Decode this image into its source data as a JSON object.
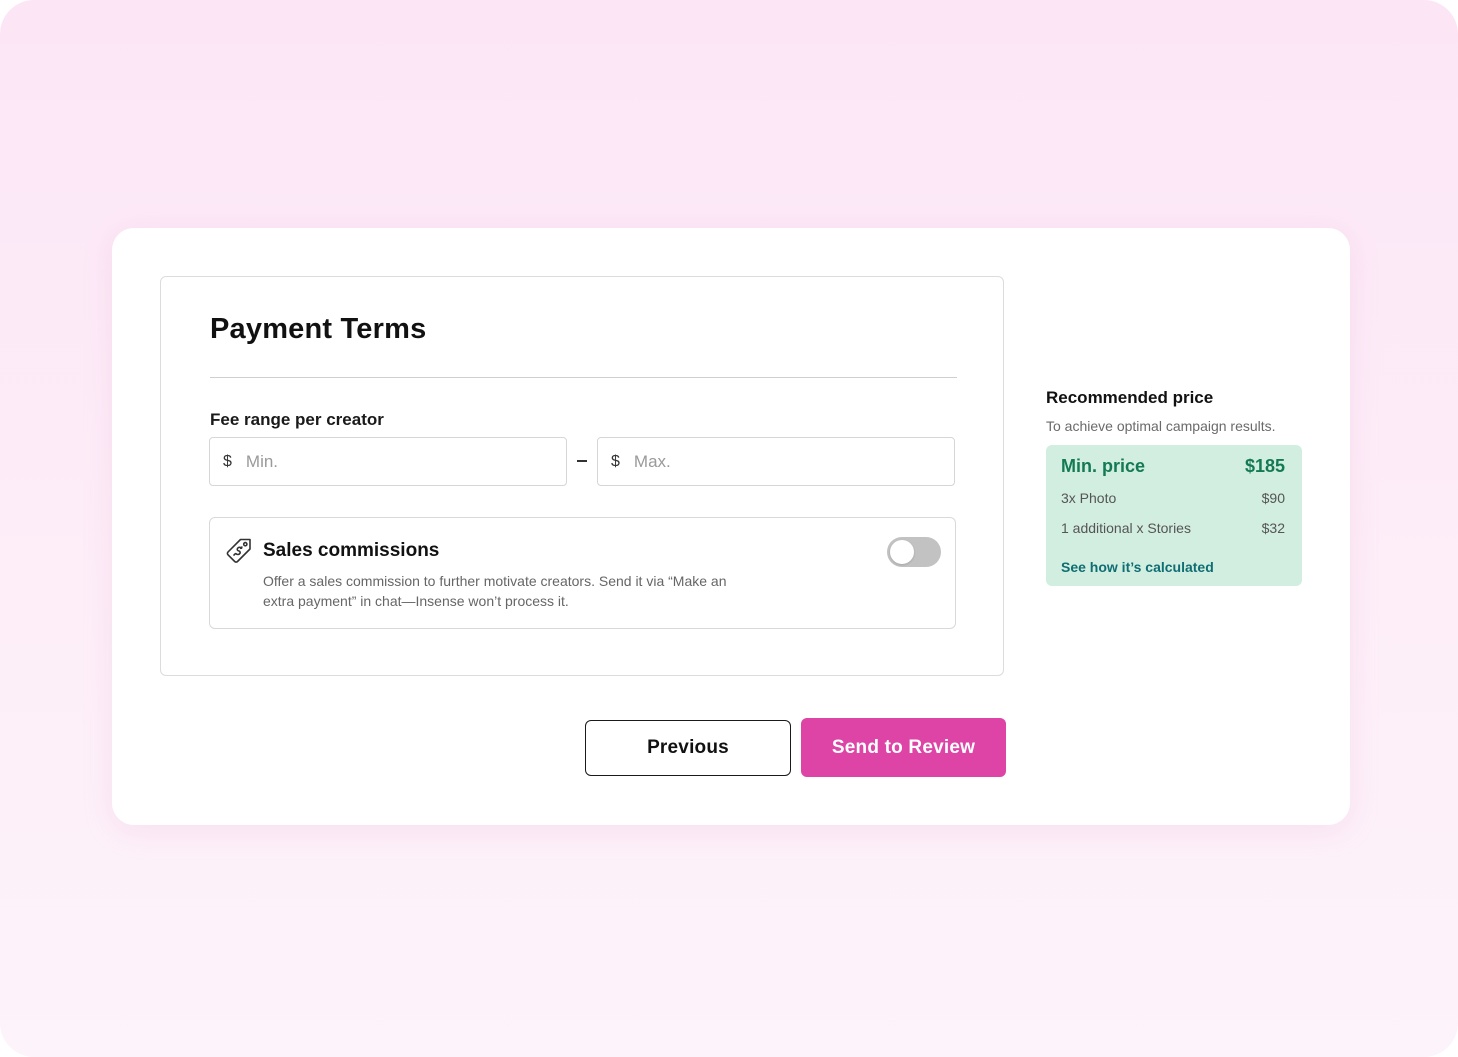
{
  "payment_terms": {
    "title": "Payment Terms",
    "fee_label": "Fee range per creator",
    "min_input": {
      "currency": "$",
      "placeholder": "Min.",
      "value": ""
    },
    "range_separator": "-",
    "max_input": {
      "currency": "$",
      "placeholder": "Max.",
      "value": ""
    },
    "sales_commissions": {
      "icon": "price-tag-dollar-icon",
      "title": "Sales commissions",
      "description": "Offer a sales commission to further motivate creators. Send it via “Make an extra payment” in chat—Insense won’t process it.",
      "toggle_on": false
    }
  },
  "recommended": {
    "title": "Recommended price",
    "subtitle": "To achieve optimal campaign results.",
    "min_price_label": "Min. price",
    "min_price_value": "$185",
    "items": [
      {
        "label": "3x Photo",
        "value": "$90"
      },
      {
        "label": "1 additional x Stories",
        "value": "$32"
      }
    ],
    "link": "See how it’s calculated"
  },
  "actions": {
    "previous_label": "Previous",
    "review_label": "Send to Review"
  },
  "colors": {
    "accent": "#de44a6",
    "price_box_bg": "#d2eee0",
    "price_green": "#137a55",
    "link_teal": "#0f6e73",
    "toggle_off": "#c2c2c2"
  }
}
